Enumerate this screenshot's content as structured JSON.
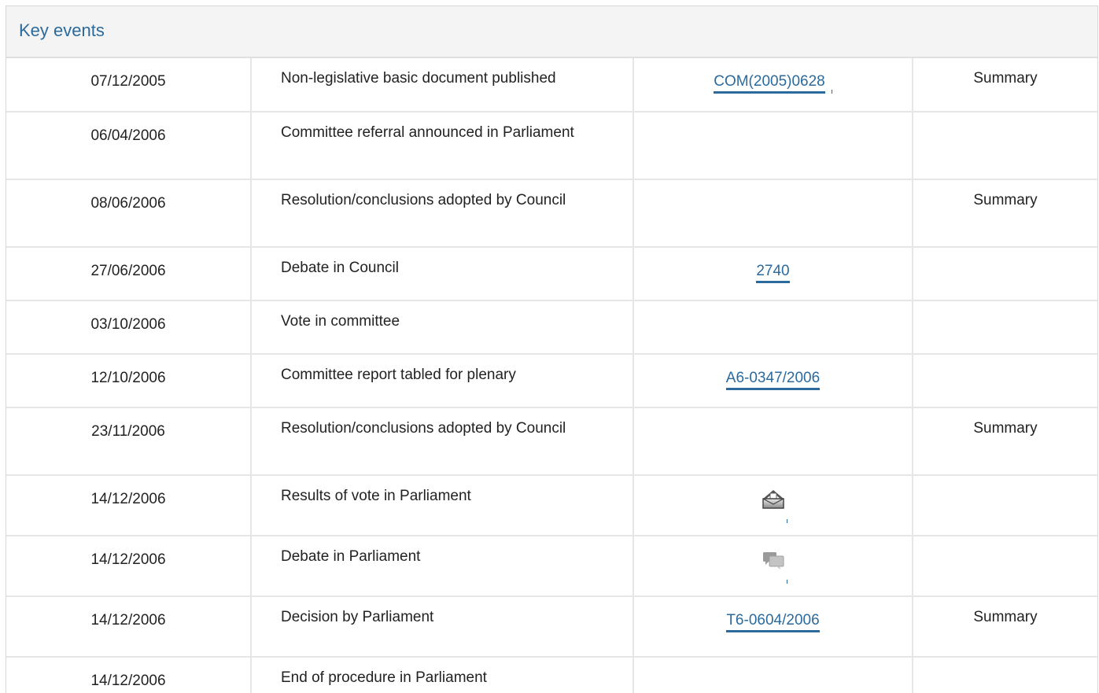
{
  "panel": {
    "title": "Key events"
  },
  "events": [
    {
      "date": "07/12/2005",
      "event": "Non-legislative basic document published",
      "ref": "COM(2005)0628",
      "summary": "Summary"
    },
    {
      "date": "06/04/2006",
      "event": "Committee referral announced in Parliament",
      "ref": "",
      "summary": ""
    },
    {
      "date": "08/06/2006",
      "event": "Resolution/conclusions adopted by Council",
      "ref": "",
      "summary": "Summary"
    },
    {
      "date": "27/06/2006",
      "event": "Debate in Council",
      "ref": "2740",
      "summary": ""
    },
    {
      "date": "03/10/2006",
      "event": "Vote in committee",
      "ref": "",
      "summary": ""
    },
    {
      "date": "12/10/2006",
      "event": "Committee report tabled for plenary",
      "ref": "A6-0347/2006",
      "summary": ""
    },
    {
      "date": "23/11/2006",
      "event": "Resolution/conclusions adopted by Council",
      "ref": "",
      "summary": "Summary"
    },
    {
      "date": "14/12/2006",
      "event": "Results of vote in Parliament",
      "ref_icon": "ballot-box-icon",
      "summary": ""
    },
    {
      "date": "14/12/2006",
      "event": "Debate in Parliament",
      "ref_icon": "speech-bubbles-icon",
      "summary": ""
    },
    {
      "date": "14/12/2006",
      "event": "Decision by Parliament",
      "ref": "T6-0604/2006",
      "summary": "Summary"
    },
    {
      "date": "14/12/2006",
      "event": "End of procedure in Parliament",
      "ref": "",
      "summary": ""
    }
  ],
  "colors": {
    "link": "#2b6a9c",
    "header_bg": "#f4f4f4",
    "border": "#e6e6e6"
  }
}
